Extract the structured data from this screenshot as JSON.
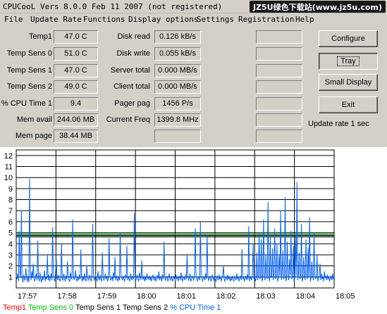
{
  "titlebar": {
    "title": "CPUCooL  Vers 8.0.0  Feb 11 2007  (not registered)",
    "watermark": "JZ5U绿色下载站(www.jz5u.com)"
  },
  "menu": [
    "File",
    "Update Rate",
    "Functions",
    "Display options",
    "Settings",
    "Registration",
    "Help"
  ],
  "stats_left": [
    {
      "label": "Temp1",
      "value": "47.0 C"
    },
    {
      "label": "Temp Sens 0",
      "value": "51.0 C"
    },
    {
      "label": "Temp Sens 1",
      "value": "47.0 C"
    },
    {
      "label": "Temp Sens 2",
      "value": "49.0 C"
    },
    {
      "label": "% CPU Time 1",
      "value": "9.4"
    },
    {
      "label": "Mem avail",
      "value": "244.06 MB"
    },
    {
      "label": "Mem page",
      "value": "38.44 MB"
    }
  ],
  "stats_mid": [
    {
      "label": "Disk read",
      "value": "0.126 kB/s"
    },
    {
      "label": "Disk write",
      "value": "0.055 kB/s"
    },
    {
      "label": "Server total",
      "value": "0.000 MB/s"
    },
    {
      "label": "Client total",
      "value": "0.000 MB/s"
    },
    {
      "label": "Pager pag",
      "value": "1456 P/s"
    },
    {
      "label": "Current Freq",
      "value": "1399.8 MHz"
    },
    {
      "label": "",
      "value": ""
    }
  ],
  "buttons": {
    "configure": "Configure",
    "tray": "Tray",
    "small_display": "Small Display",
    "exit": "Exit"
  },
  "update_rate": "Update rate 1 sec",
  "chart_data": {
    "type": "line",
    "x_ticks": [
      "17:57",
      "17:58",
      "17:59",
      "18:00",
      "18:01",
      "18:02",
      "18:03",
      "18:04",
      "18:05"
    ],
    "y_ticks": [
      "1",
      "2",
      "3",
      "4",
      "5",
      "6",
      "7",
      "8",
      "9",
      "10",
      "11",
      "12"
    ],
    "ylim": [
      0,
      12.5
    ],
    "grid": true,
    "series": [
      {
        "name": "Temp1",
        "color": "#ff0000"
      },
      {
        "name": "Temp Sens 0",
        "color": "#00c000"
      },
      {
        "name": "Temp Sens 1",
        "color": "#000000"
      },
      {
        "name": "Temp Sens 2",
        "color": "#000000"
      },
      {
        "name": "% CPU Time 1",
        "color": "#0060ff"
      }
    ],
    "flat_level": 4.75,
    "cpu_values": [
      1.1,
      0.8,
      1.3,
      0.6,
      5.2,
      1.4,
      0.9,
      7.0,
      1.0,
      0.5,
      1.2,
      0.8,
      0.7,
      1.8,
      0.9,
      0.6,
      1.1,
      0.5,
      9.9,
      1.2,
      0.7,
      1.5,
      0.9,
      2.2,
      0.8,
      0.6,
      1.0,
      1.3,
      0.7,
      4.3,
      0.9,
      0.6,
      1.4,
      0.8,
      0.5,
      1.1,
      0.7,
      0.9,
      1.6,
      0.6,
      1.0,
      0.8,
      3.0,
      0.7,
      1.2,
      0.6,
      0.9,
      1.3,
      0.7,
      5.5,
      1.1,
      0.8,
      0.6,
      1.5,
      2.6,
      0.9,
      0.7,
      1.2,
      0.8,
      0.6,
      1.0,
      4.0,
      0.8,
      0.7,
      1.3,
      0.9,
      0.6,
      1.1,
      0.8,
      2.4,
      1.0,
      0.7,
      0.6,
      1.4,
      0.9,
      0.8,
      6.2,
      1.1,
      0.7,
      0.9,
      1.6,
      0.8,
      0.6,
      1.0,
      0.7,
      1.2,
      0.8,
      3.5,
      0.9,
      0.6,
      1.1,
      0.7,
      1.3,
      0.8,
      0.6,
      2.0,
      1.0,
      0.7,
      0.9,
      1.2,
      0.8,
      0.6,
      1.4,
      5.8,
      1.0,
      0.7,
      0.9,
      1.1,
      0.8,
      0.6,
      1.5,
      0.9,
      0.7,
      1.2,
      0.8,
      0.6,
      3.2,
      1.0,
      0.7,
      0.9,
      1.3,
      0.8,
      1.1,
      0.6,
      0.9,
      4.5,
      1.2,
      0.7,
      0.8,
      1.0,
      0.6,
      1.4,
      0.9,
      2.8,
      0.7,
      1.1,
      0.8,
      0.6,
      1.0,
      0.7,
      5.0,
      1.3,
      0.9,
      0.7,
      1.1,
      0.8,
      0.6,
      1.2,
      0.9,
      3.8,
      0.7,
      1.0,
      0.8,
      0.6,
      1.3,
      0.9,
      0.7,
      1.1,
      0.8,
      6.8,
      1.0,
      0.7,
      0.9,
      1.2,
      0.8,
      0.6,
      1.4,
      1.0,
      0.7,
      2.5,
      0.9,
      0.8,
      1.1,
      0.6,
      1.0,
      0.7,
      1.3,
      0.9,
      0.8,
      1.1,
      0.7,
      1.0,
      0.6,
      0.9,
      1.2,
      0.8,
      0.7,
      1.0,
      0.6,
      0.9,
      1.1,
      0.8,
      1.5,
      0.7,
      1.0,
      0.9,
      0.6,
      1.2,
      0.8,
      4.2,
      1.0,
      0.7,
      0.9,
      1.1,
      0.6,
      0.8,
      1.3,
      0.9,
      0.7,
      1.0,
      0.8,
      0.6,
      1.1,
      0.9,
      0.7,
      1.2,
      0.8,
      1.0,
      0.6,
      0.9,
      1.1,
      0.7,
      1.4,
      0.8,
      0.6,
      1.0,
      0.9,
      0.7,
      1.2,
      0.8,
      3.0,
      1.0,
      0.7,
      0.9,
      1.3,
      0.6,
      0.8,
      1.1,
      0.9,
      0.7,
      1.0,
      5.4,
      1.2,
      0.8,
      0.6,
      1.0,
      0.9,
      0.7,
      6.0,
      1.1,
      0.8,
      0.6,
      1.0,
      0.9,
      0.7,
      1.3,
      0.8,
      4.8,
      1.0,
      0.7,
      0.9,
      1.1,
      0.6,
      0.8,
      1.2,
      0.9,
      0.7,
      1.0,
      0.8,
      0.6,
      1.1,
      0.9,
      0.7,
      1.2,
      0.8,
      1.0,
      0.6,
      0.9,
      1.1,
      2.0,
      0.8,
      0.6,
      1.0,
      0.9,
      0.7,
      1.2,
      0.8,
      1.0,
      0.6,
      0.9,
      0.7,
      1.1,
      0.8,
      0.6,
      1.0,
      0.9,
      0.7,
      1.3,
      0.8,
      1.0,
      0.6,
      0.9,
      1.1,
      0.7,
      3.5,
      0.8,
      1.0,
      0.6,
      0.9,
      1.1,
      0.7,
      1.2,
      0.8,
      5.6,
      0.6,
      1.0,
      0.9,
      0.7,
      1.3,
      4.0,
      0.8,
      1.1,
      0.6,
      0.9,
      3.2,
      0.7,
      1.2,
      5.0,
      0.8,
      1.0,
      4.4,
      0.6,
      0.9,
      6.2,
      1.1,
      0.7,
      3.0,
      1.3,
      0.8,
      7.8,
      1.0,
      0.6,
      4.6,
      0.9,
      1.1,
      3.6,
      0.7,
      1.2,
      5.4,
      0.8,
      1.0,
      4.0,
      0.6,
      0.9,
      3.0,
      1.1,
      7.0,
      0.7,
      1.3,
      3.4,
      0.8,
      1.0,
      8.2,
      0.6,
      0.9,
      4.2,
      1.1,
      0.7,
      2.6,
      1.2,
      5.2,
      0.8,
      1.0,
      3.8,
      0.6,
      0.9,
      4.6,
      1.1,
      9.6,
      0.7,
      1.3,
      3.2,
      0.8,
      1.0,
      5.8,
      0.6,
      0.9,
      2.8,
      1.1,
      0.7,
      4.4,
      1.2,
      0.8,
      3.6,
      1.0,
      6.4,
      0.6,
      0.9,
      2.4,
      1.1,
      0.7,
      5.0,
      1.2,
      0.8,
      1.0,
      3.0,
      0.6,
      0.9,
      1.1,
      2.2,
      0.7,
      1.3,
      0.8,
      1.0,
      0.6,
      1.5,
      0.9,
      1.1,
      0.7,
      1.2,
      0.8,
      1.0,
      0.6,
      0.9,
      1.1,
      0.7,
      1.3,
      0.8,
      1.0
    ]
  },
  "legend": [
    {
      "label": "Temp1",
      "color": "#ff0000"
    },
    {
      "label": "Temp Sens 0",
      "color": "#00c000"
    },
    {
      "label": "Temp Sens 1",
      "color": "#000000"
    },
    {
      "label": "Temp Sens 2",
      "color": "#000000"
    },
    {
      "label": "% CPU Time 1",
      "color": "#0060ff"
    }
  ]
}
